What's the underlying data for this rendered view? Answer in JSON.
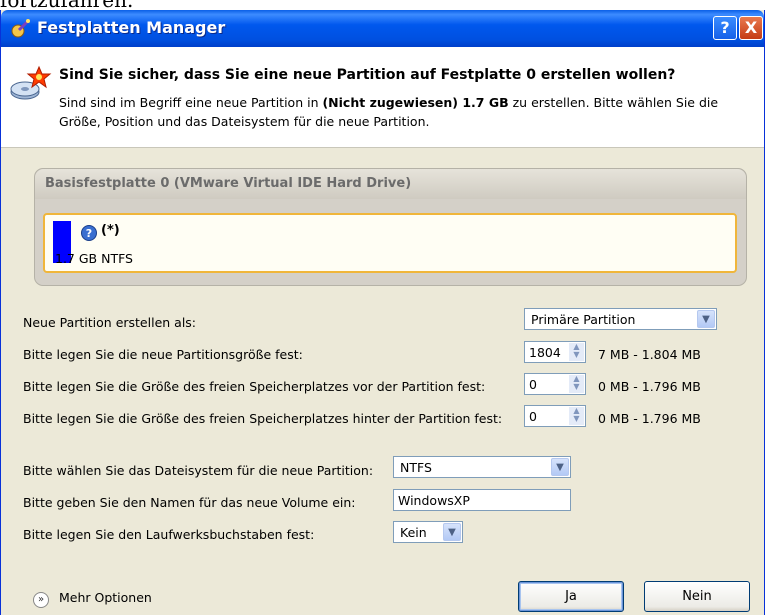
{
  "background_text": "fortzufahren.",
  "window": {
    "title": "Festplatten Manager",
    "help_glyph": "?",
    "close_glyph": "X"
  },
  "header": {
    "title": "Sind Sie sicher, dass Sie eine neue Partition auf Festplatte 0 erstellen wollen?",
    "desc_prefix": "Sind sind im Begriff eine neue Partition in ",
    "desc_bold": "(Nicht zugewiesen) 1.7 GB",
    "desc_suffix": " zu erstellen. Bitte wählen Sie die Größe, Position und das Dateisystem für die neue Partition."
  },
  "disk": {
    "title": "Basisfestplatte 0 (VMware Virtual IDE Hard Drive)",
    "partition_name": "(*)",
    "partition_size": "1.7 GB NTFS",
    "partition_color": "#0000ff"
  },
  "form": {
    "create_as_label": "Neue Partition erstellen als:",
    "create_as_value": "Primäre Partition",
    "size_label": "Bitte legen Sie die neue Partitionsgröße fest:",
    "size_value": "1804",
    "size_range": "7 MB - 1.804 MB",
    "before_label": "Bitte legen Sie die Größe des freien Speicherplatzes vor der Partition fest:",
    "before_value": "0",
    "before_range": "0 MB - 1.796 MB",
    "after_label": "Bitte legen Sie die Größe des freien Speicherplatzes hinter der Partition fest:",
    "after_value": "0",
    "after_range": "0 MB - 1.796 MB",
    "fs_label": "Bitte wählen Sie das Dateisystem für die neue Partition:",
    "fs_value": "NTFS",
    "volname_label": "Bitte geben Sie den Namen für das neue Volume ein:",
    "volname_value": "WindowsXP",
    "drive_label": "Bitte legen Sie den Laufwerksbuchstaben fest:",
    "drive_value": "Kein"
  },
  "footer": {
    "more_options": "Mehr Optionen",
    "yes": "Ja",
    "no": "Nein"
  },
  "icons": [
    "wizard-icon",
    "disk-star-icon",
    "help-circle-icon",
    "chevron-down-icon",
    "spin-arrows-icon",
    "expand-circle-icon"
  ]
}
